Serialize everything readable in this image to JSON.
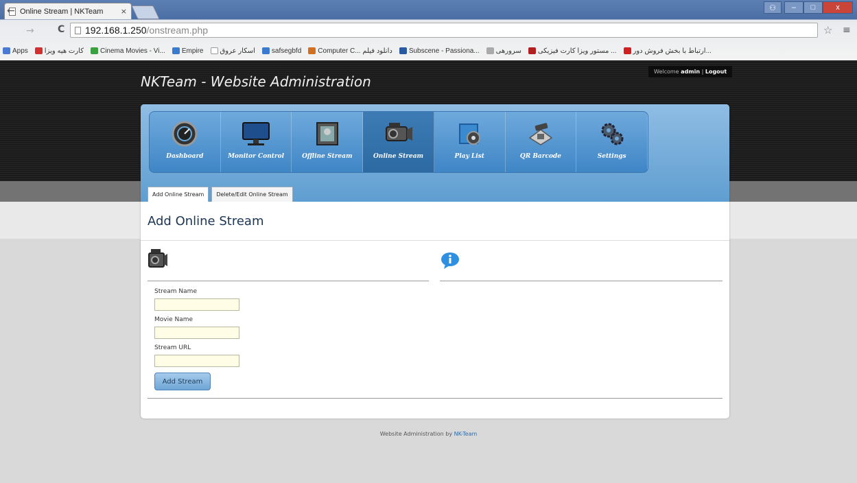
{
  "browser": {
    "tab_title": "Online Stream | NKTeam",
    "tab_close": "×",
    "url_host": "192.168.1.250",
    "url_path": "/onstream.php",
    "back": "←",
    "forward": "→",
    "reload": "C",
    "star": "☆",
    "menu": "≡",
    "window_buttons": {
      "minimize": "–",
      "maximize": "□",
      "close": "x"
    },
    "bookmarks": [
      {
        "label": "Apps",
        "color": "#4a7bd0"
      },
      {
        "label": "کارت هیه ویزا",
        "color": "#d03030"
      },
      {
        "label": "Cinema Movies - Vi...",
        "color": "#3aa040"
      },
      {
        "label": "Empire",
        "color": "#3a7bd0"
      },
      {
        "label": "اسکار عروق",
        "color": "#999999"
      },
      {
        "label": "safsegbfd",
        "color": "#3a7bd0"
      },
      {
        "label": "Computer C... دانلود فیلم",
        "color": "#d07020"
      },
      {
        "label": "Subscene - Passiona...",
        "color": "#2a5aa0"
      },
      {
        "label": "سرورهی",
        "color": "#aaaaaa"
      },
      {
        "label": "مستور ویزا کارت فیزیکی ...",
        "color": "#b02020"
      },
      {
        "label": "ارتباط با بخش فروش دور...",
        "color": "#d02020"
      }
    ]
  },
  "site": {
    "title": "NKTeam - Website Administration",
    "welcome_text": "Welcome",
    "user": "admin",
    "separator": "|",
    "logout": "Logout"
  },
  "nav": [
    {
      "label": "Dashboard",
      "icon": "dashboard-icon",
      "active": false
    },
    {
      "label": "Monitor Control",
      "icon": "monitor-icon",
      "active": false
    },
    {
      "label": "Offline Stream",
      "icon": "film-icon",
      "active": false
    },
    {
      "label": "Online Stream",
      "icon": "camcorder-icon",
      "active": true
    },
    {
      "label": "Play List",
      "icon": "playlist-icon",
      "active": false
    },
    {
      "label": "QR Barcode",
      "icon": "qr-scanner-icon",
      "active": false
    },
    {
      "label": "Settings",
      "icon": "gears-icon",
      "active": false
    }
  ],
  "subtabs": [
    {
      "label": "Add Online Stream",
      "active": true
    },
    {
      "label": "Delete/Edit Online Stream",
      "active": false
    }
  ],
  "page": {
    "heading": "Add Online Stream"
  },
  "form": {
    "stream_name_label": "Stream Name",
    "movie_name_label": "Movie Name",
    "stream_url_label": "Stream URL",
    "submit_label": "Add Stream"
  },
  "footer": {
    "text": "Website Administration by",
    "link": "NK-Team"
  },
  "colors": {
    "accent": "#5f9ed1",
    "header_bg": "#222222",
    "input_bg": "#fffde6"
  }
}
